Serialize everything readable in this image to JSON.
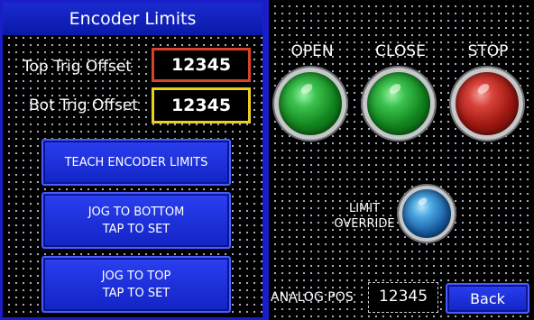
{
  "encoder_panel": {
    "title": "Encoder Limits",
    "top_trig": {
      "label": "Top Trig Offset",
      "value": "12345",
      "border_color": "#d8422a"
    },
    "bot_trig": {
      "label": "Bot Trig Offset",
      "value": "12345",
      "border_color": "#e8d020"
    },
    "buttons": {
      "teach": "TEACH ENCODER LIMITS",
      "jog_bottom_line1": "JOG TO BOTTOM",
      "jog_bottom_line2": "TAP TO SET",
      "jog_top_line1": "JOG TO TOP",
      "jog_top_line2": "TAP TO SET"
    }
  },
  "status_panel": {
    "lights": [
      {
        "label": "OPEN",
        "color": "green"
      },
      {
        "label": "CLOSE",
        "color": "green"
      },
      {
        "label": "STOP",
        "color": "red"
      }
    ],
    "limit_override": {
      "line1": "LIMIT",
      "line2": "OVERRIDE",
      "color": "blue"
    },
    "analog_pos": {
      "label": "ANALOG POS",
      "value": "12345"
    },
    "back_label": "Back"
  },
  "colors": {
    "accent_blue": "#1a1ec8",
    "button_blue": "#1a2fe0",
    "open_light": "#1f9b2e",
    "close_light": "#1f9b2e",
    "stop_light": "#b8221a",
    "override_light": "#2a7cc4"
  }
}
